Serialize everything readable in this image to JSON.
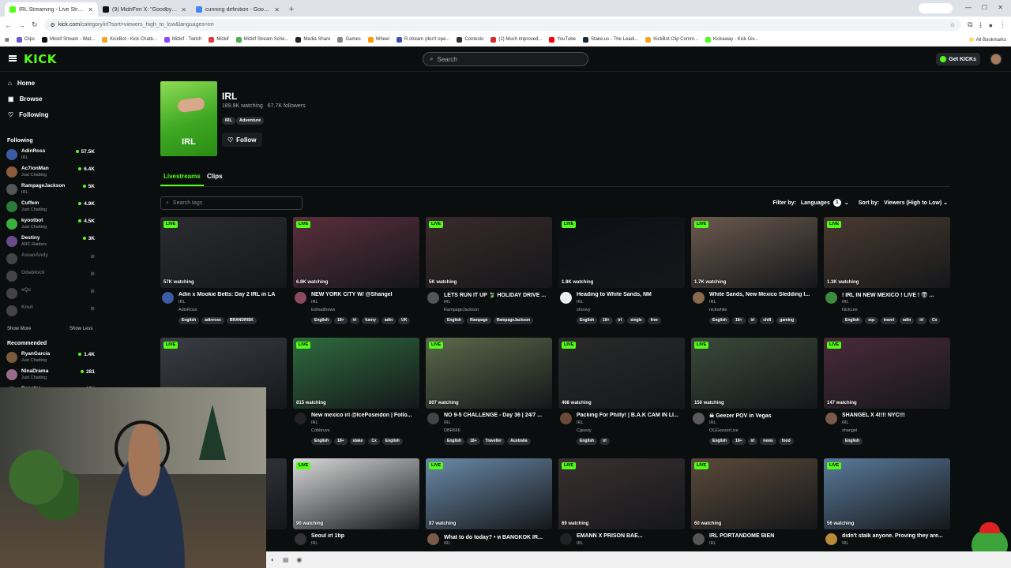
{
  "browser": {
    "tabs": [
      {
        "label": "IRL Streaming - Live Streams on Kick",
        "color": "#53fc18",
        "active": true
      },
      {
        "label": "(9) MidriFen X: \"Goodbye Twitch\"",
        "color": "#111111",
        "active": false
      },
      {
        "label": "cunning definition - Google Search",
        "color": "#4285f4",
        "active": false
      }
    ],
    "new_tab": "+",
    "gemini": "Gemini",
    "url_host": "kick.com",
    "url_rest": "/category/irl?sort=viewers_high_to_low&languages=en",
    "bookmarks": [
      {
        "label": "Clips",
        "color": "#6a5acd"
      },
      {
        "label": "Mickif Stream - Wat...",
        "color": "#111111"
      },
      {
        "label": "KickBot - Kick Chatb...",
        "color": "#f5a623"
      },
      {
        "label": "Mizkif - Twitch",
        "color": "#9146ff"
      },
      {
        "label": "Mizkif",
        "color": "#e23b3b"
      },
      {
        "label": "Mizkif Stream Sche...",
        "color": "#4caf50"
      },
      {
        "label": "Media Share",
        "color": "#222222"
      },
      {
        "label": "Games",
        "color": "#888888"
      },
      {
        "label": "Wheel",
        "color": "#ff9800"
      },
      {
        "label": "R.stream (don't ope...",
        "color": "#3f51b5"
      },
      {
        "label": "Contexto",
        "color": "#333333"
      },
      {
        "label": "(1) Much improved...",
        "color": "#d32f2f"
      },
      {
        "label": "YouTube",
        "color": "#ff0000"
      },
      {
        "label": "Stake.us - The Leadi...",
        "color": "#1b2836"
      },
      {
        "label": "KickBot Clip Comm...",
        "color": "#f5a623"
      },
      {
        "label": "Kickaway - Kick Giv...",
        "color": "#53fc18"
      }
    ],
    "all_bookmarks": "All Bookmarks"
  },
  "header": {
    "logo": "KICK",
    "search_placeholder": "Search",
    "get_kicks": "Get KICKs"
  },
  "sidebar": {
    "nav": [
      {
        "label": "Home",
        "icon": "home-icon"
      },
      {
        "label": "Browse",
        "icon": "browse-icon"
      },
      {
        "label": "Following",
        "icon": "heart-icon"
      }
    ],
    "following_title": "Following",
    "following": [
      {
        "name": "AdinRoss",
        "category": "IRL",
        "viewers": "57.5K",
        "online": true,
        "color": "#3b5ba5"
      },
      {
        "name": "Ac7ionMan",
        "category": "Just Chatting",
        "viewers": "6.4K",
        "online": true,
        "color": "#8a5b3c"
      },
      {
        "name": "RampageJackson",
        "category": "IRL",
        "viewers": "5K",
        "online": true,
        "color": "#555555"
      },
      {
        "name": "Cuffem",
        "category": "Just Chatting",
        "viewers": "4.9K",
        "online": true,
        "color": "#2a7a3a"
      },
      {
        "name": "kyootbot",
        "category": "Just Chatting",
        "viewers": "4.5K",
        "online": true,
        "color": "#3cae3c"
      },
      {
        "name": "Destiny",
        "category": "ARC Raiders",
        "viewers": "3K",
        "online": true,
        "color": "#6b4a8a"
      },
      {
        "name": "AsianAndy",
        "category": "",
        "viewers": "",
        "online": false,
        "color": "#444444"
      },
      {
        "name": "Odablock",
        "category": "",
        "viewers": "",
        "online": false,
        "color": "#444444"
      },
      {
        "name": "xQc",
        "category": "",
        "viewers": "",
        "online": false,
        "color": "#444444"
      },
      {
        "name": "Knut",
        "category": "",
        "viewers": "",
        "online": false,
        "color": "#444444"
      }
    ],
    "show_more": "Show More",
    "show_less": "Show Less",
    "recommended_title": "Recommended",
    "recommended": [
      {
        "name": "RyanGarcia",
        "category": "Just Chatting",
        "viewers": "1.4K",
        "color": "#7b5b3c"
      },
      {
        "name": "NinaDrama",
        "category": "Just Chatting",
        "viewers": "281",
        "color": "#9b6b8c"
      },
      {
        "name": "Sanotar",
        "category": "",
        "viewers": "374",
        "color": "#555555"
      }
    ]
  },
  "category": {
    "name": "IRL",
    "cover_label": "IRL",
    "watching": "189.8K watching",
    "followers": "67.7K followers",
    "tags": [
      "IRL",
      "Adventure"
    ],
    "follow_label": "Follow"
  },
  "tabs": {
    "livestreams": "Livestreams",
    "clips": "Clips"
  },
  "filters": {
    "search_tags_placeholder": "Search tags",
    "filter_by": "Filter by:",
    "languages": "Languages",
    "languages_count": "1",
    "sort_by": "Sort by:",
    "sort_value": "Viewers (High to Low)"
  },
  "live_badge": "LIVE",
  "streams": [
    {
      "watching": "57K watching",
      "title": "Adin x Mookie Betts: Day 2 IRL in LA",
      "category": "IRL",
      "user": "AdinRoss",
      "tags": [
        "English",
        "adinross",
        "BRANDRISK"
      ],
      "thumb": "#2b2c30",
      "avatar": "#3b5ba5"
    },
    {
      "watching": "6.8K watching",
      "title": "NEW YORK CITY W/ @Shangel",
      "category": "IRL",
      "user": "Edmatthews",
      "tags": [
        "English",
        "18+",
        "irl",
        "funny",
        "adin",
        "UK"
      ],
      "thumb": "#5a2f3c",
      "avatar": "#8a4a5c"
    },
    {
      "watching": "5K watching",
      "title": "LETS RUN IT UP 🍃 HOLIDAY DRIVE ...",
      "category": "IRL",
      "user": "RampageJackson",
      "tags": [
        "English",
        "Rampage",
        "RampageJackson"
      ],
      "thumb": "#3a2a2a",
      "avatar": "#555555"
    },
    {
      "watching": "1.8K watching",
      "title": "Heading to White Sands, NM",
      "category": "IRL",
      "user": "shoovy",
      "tags": [
        "English",
        "18+",
        "irl",
        "single",
        "free"
      ],
      "thumb": "#0c0f14",
      "avatar": "#eeeeee"
    },
    {
      "watching": "1.7K watching",
      "title": "White Sands, New Mexico Sledding I...",
      "category": "IRL",
      "user": "nickwhite",
      "tags": [
        "English",
        "18+",
        "irl",
        "chill",
        "gaming"
      ],
      "thumb": "#6b5a4e",
      "avatar": "#8a6a4e"
    },
    {
      "watching": "1.3K watching",
      "title": "! IRL IN NEW MEXICO ! LIVE ! 👽 ...",
      "category": "IRL",
      "user": "NickLee",
      "tags": [
        "English",
        "xqc",
        "travel",
        "adin",
        "irl",
        "Cx"
      ],
      "thumb": "#4a3a30",
      "avatar": "#3c8a3c"
    },
    {
      "watching": "",
      "title": "",
      "category": "",
      "user": "",
      "tags": [],
      "thumb": "#3a3e44",
      "avatar": "#666666"
    },
    {
      "watching": "815 watching",
      "title": "New mexico irl @IcePoseidon | Follo...",
      "category": "IRL",
      "user": "Cobbruvs",
      "tags": [
        "English",
        "18+",
        "stake",
        "Cx",
        "English"
      ],
      "thumb": "#2e6b3e",
      "avatar": "#222222"
    },
    {
      "watching": "807 watching",
      "title": "NO 9-5 CHALLENGE - Day 36 | 24/7 ...",
      "category": "IRL",
      "user": "DBR666",
      "tags": [
        "English",
        "18+",
        "Traveller",
        "Australia"
      ],
      "thumb": "#5a6a4a",
      "avatar": "#444444"
    },
    {
      "watching": "468 watching",
      "title": "Packing For Philly! | B.A.K CAM IN LI...",
      "category": "IRL",
      "user": "Cgeezy",
      "tags": [
        "English",
        "irl"
      ],
      "thumb": "#2a2a2a",
      "avatar": "#6b4a3a"
    },
    {
      "watching": "150 watching",
      "title": "☠ Geezer POV in Vegas",
      "category": "IRL",
      "user": "OGGeezerLive",
      "tags": [
        "English",
        "18+",
        "irl",
        "news",
        "food"
      ],
      "thumb": "#3a4a3a",
      "avatar": "#5a5a5a"
    },
    {
      "watching": "147 watching",
      "title": "SHANGEL X 4!!!! NYC!!!",
      "category": "IRL",
      "user": "shangel",
      "tags": [
        "English"
      ],
      "thumb": "#4a2a3a",
      "avatar": "#7a5a4a"
    },
    {
      "watching": "",
      "title": "",
      "category": "",
      "user": "",
      "tags": [],
      "thumb": "#3a3e44",
      "avatar": "#666666"
    },
    {
      "watching": "90 watching",
      "title": "Seoul irl 1tip",
      "category": "IRL",
      "user": "",
      "tags": [],
      "thumb": "#d8d8d8",
      "avatar": "#333333"
    },
    {
      "watching": "87 watching",
      "title": "What to do today? • ท BANGKOK IR...",
      "category": "IRL",
      "user": "",
      "tags": [],
      "thumb": "#6a8aa8",
      "avatar": "#7a5a4a"
    },
    {
      "watching": "69 watching",
      "title": "EMANN X PRISON BAE...",
      "category": "IRL",
      "user": "",
      "tags": [],
      "thumb": "#3a3030",
      "avatar": "#222222"
    },
    {
      "watching": "60 watching",
      "title": "IRL PORTÁNDOME BIEN",
      "category": "IRL",
      "user": "",
      "tags": [],
      "thumb": "#5a4a3a",
      "avatar": "#555555"
    },
    {
      "watching": "56 watching",
      "title": "didn't stalk anyone. Proving they are...",
      "category": "IRL",
      "user": "",
      "tags": [],
      "thumb": "#5a7a9a",
      "avatar": "#b88a3a"
    }
  ]
}
